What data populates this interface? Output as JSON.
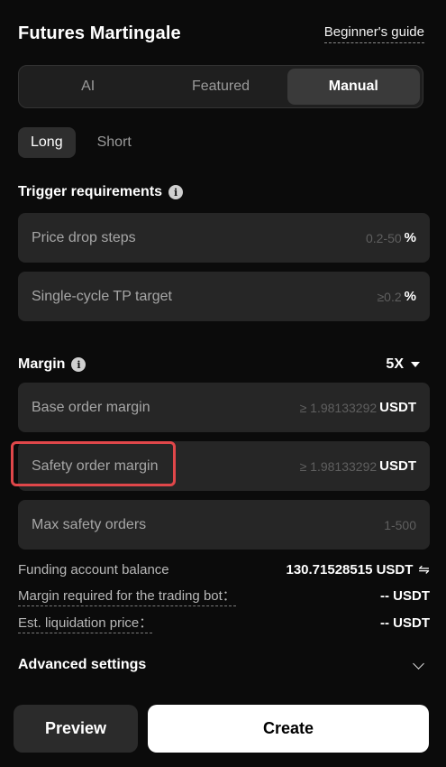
{
  "header": {
    "title": "Futures Martingale",
    "guide_label": "Beginner's guide"
  },
  "modes": [
    {
      "label": "AI",
      "active": false
    },
    {
      "label": "Featured",
      "active": false
    },
    {
      "label": "Manual",
      "active": true
    }
  ],
  "direction": [
    {
      "label": "Long",
      "active": true
    },
    {
      "label": "Short",
      "active": false
    }
  ],
  "trigger": {
    "label": "Trigger requirements",
    "fields": [
      {
        "label": "Price drop steps",
        "placeholder": "0.2-50",
        "unit": "%"
      },
      {
        "label": "Single-cycle TP target",
        "placeholder": "≥0.2",
        "unit": "%"
      }
    ]
  },
  "margin": {
    "label": "Margin",
    "leverage": "5X",
    "fields": [
      {
        "label": "Base order margin",
        "placeholder": "≥ 1.98133292",
        "unit": "USDT"
      },
      {
        "label": "Safety order margin",
        "placeholder": "≥ 1.98133292",
        "unit": "USDT"
      },
      {
        "label": "Max safety orders",
        "placeholder": "1-500",
        "unit": ""
      }
    ]
  },
  "info": [
    {
      "label": "Funding account balance",
      "value": "130.71528515 USDT"
    },
    {
      "label": "Margin required for the trading bot：",
      "value": "-- USDT"
    },
    {
      "label": "Est. liquidation price：",
      "value": "-- USDT"
    }
  ],
  "advanced": {
    "label": "Advanced settings"
  },
  "actions": {
    "preview_label": "Preview",
    "create_label": "Create"
  },
  "icons": {
    "info": "info-icon",
    "swap": "swap-icon",
    "caret": "caret-down-icon",
    "chevron": "chevron-down-icon"
  },
  "colors": {
    "background": "#0b0b0b",
    "field": "#262626",
    "highlight": "#e0474a",
    "accent_button": "#ffffff"
  }
}
